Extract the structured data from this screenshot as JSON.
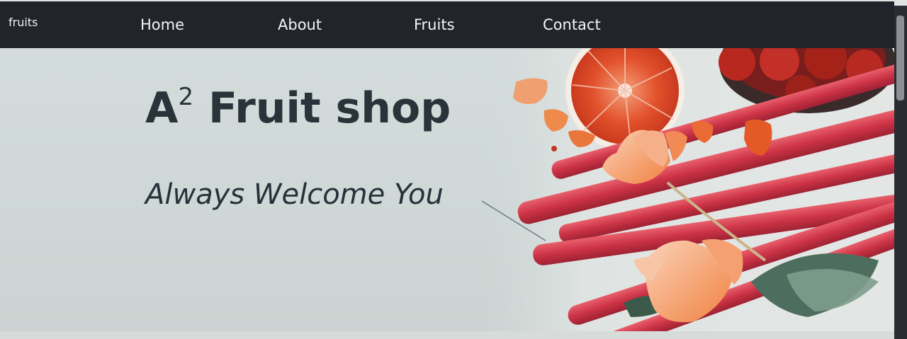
{
  "navbar": {
    "brand": "fruits",
    "links": [
      "Home",
      "About",
      "Fruits",
      "Contact"
    ]
  },
  "hero": {
    "title_prefix": "A",
    "title_sup": "2",
    "title_rest": " Fruit shop",
    "tagline": "Always Welcome You"
  },
  "colors": {
    "navbar_bg": "#22242c",
    "hero_bg": "#d3dcdb",
    "title": "#2a323a",
    "rhubarb": "#d2384a",
    "orange": "#f07a3a"
  },
  "icons": {
    "hero_image": "fruit-rhubarb-orange-photo"
  }
}
